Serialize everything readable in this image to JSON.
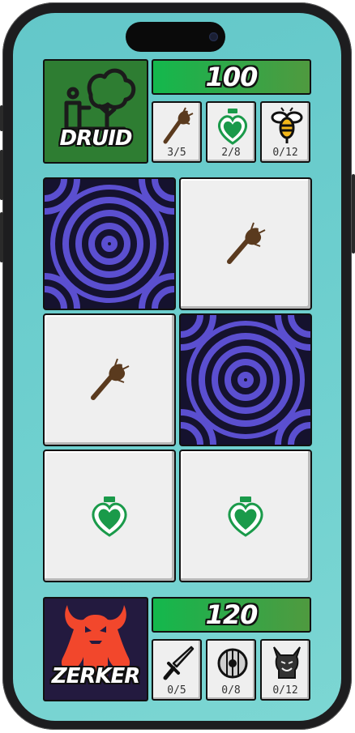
{
  "top_player": {
    "name": "DRUID",
    "hp": "100",
    "portrait_icon": "druid-tree-icon",
    "portrait_color": "#2e7d32",
    "items": [
      {
        "icon": "torch-icon",
        "count": "3/5"
      },
      {
        "icon": "heart-potion-icon",
        "count": "2/8"
      },
      {
        "icon": "bee-icon",
        "count": "0/12"
      }
    ]
  },
  "board": {
    "cards": [
      {
        "state": "hidden",
        "icon": "spiral-pattern-back"
      },
      {
        "state": "revealed",
        "icon": "torch-icon"
      },
      {
        "state": "revealed",
        "icon": "torch-icon"
      },
      {
        "state": "hidden",
        "icon": "spiral-pattern-back"
      },
      {
        "state": "revealed",
        "icon": "heart-potion-icon"
      },
      {
        "state": "revealed",
        "icon": "heart-potion-icon"
      }
    ],
    "back_colors": {
      "ring": "#5b4fd0",
      "dark": "#15122e"
    }
  },
  "bottom_player": {
    "name": "ZERKER",
    "hp": "120",
    "portrait_icon": "horned-demon-icon",
    "portrait_color": "#231a3f",
    "items": [
      {
        "icon": "sword-icon",
        "count": "0/5"
      },
      {
        "icon": "shield-icon",
        "count": "0/8"
      },
      {
        "icon": "warrior-head-icon",
        "count": "0/12"
      }
    ]
  },
  "colors": {
    "background": "#6fd0cf",
    "hp_bar": "#2fa849",
    "potion_green": "#1a9a4a",
    "torch_brown": "#5a3a1e",
    "demon_red": "#f2472c"
  }
}
